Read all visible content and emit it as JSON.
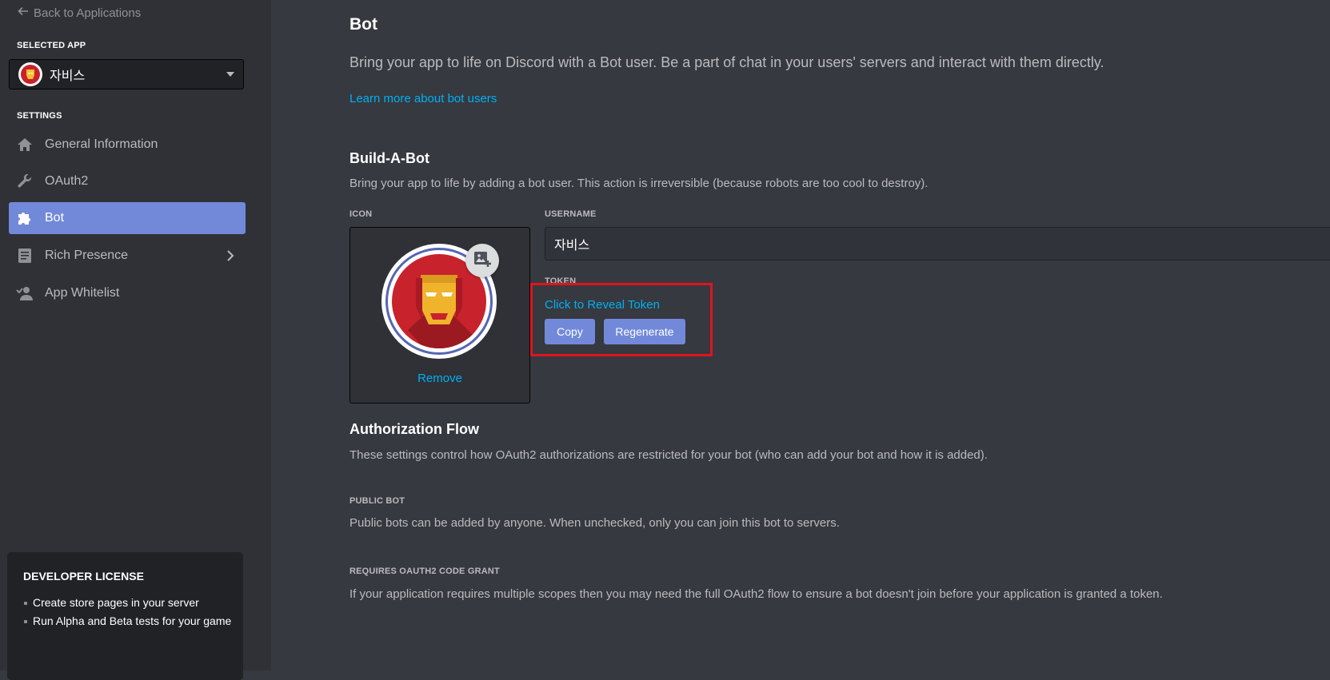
{
  "sidebar": {
    "back_label": "Back to Applications",
    "selected_app_label": "SELECTED APP",
    "app_name": "자비스",
    "settings_label": "SETTINGS",
    "items": [
      {
        "label": "General Information",
        "icon": "home-icon"
      },
      {
        "label": "OAuth2",
        "icon": "wrench-icon"
      },
      {
        "label": "Bot",
        "icon": "puzzle-icon",
        "active": true
      },
      {
        "label": "Rich Presence",
        "icon": "document-icon",
        "has_chevron": true
      },
      {
        "label": "App Whitelist",
        "icon": "person-icon"
      }
    ],
    "license": {
      "title": "DEVELOPER LICENSE",
      "items": [
        "Create store pages in your server",
        "Run Alpha and Beta tests for your game"
      ]
    }
  },
  "main": {
    "title": "Bot",
    "lead": "Bring your app to life on Discord with a Bot user. Be a part of chat in your users' servers and interact with them directly.",
    "learn_more": "Learn more about bot users",
    "build": {
      "heading": "Build-A-Bot",
      "desc": "Bring your app to life by adding a bot user. This action is irreversible (because robots are too cool to destroy).",
      "icon_label": "ICON",
      "remove_label": "Remove",
      "username_label": "USERNAME",
      "username_value": "자비스",
      "token_label": "TOKEN",
      "reveal_label": "Click to Reveal Token",
      "copy_label": "Copy",
      "regenerate_label": "Regenerate"
    },
    "auth": {
      "heading": "Authorization Flow",
      "desc": "These settings control how OAuth2 authorizations are restricted for your bot (who can add your bot and how it is added).",
      "public_label": "PUBLIC BOT",
      "public_desc": "Public bots can be added by anyone. When unchecked, only you can join this bot to servers.",
      "grant_label": "REQUIRES OAUTH2 CODE GRANT",
      "grant_desc": "If your application requires multiple scopes then you may need the full OAuth2 flow to ensure a bot doesn't join before your application is granted a token."
    }
  },
  "colors": {
    "accent": "#7289da",
    "link": "#00b0f4",
    "highlight": "#e0141e",
    "background": "#36393f",
    "sidebar": "#2f3136"
  }
}
